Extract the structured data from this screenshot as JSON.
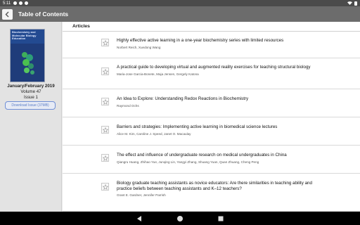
{
  "status": {
    "time": "5:11"
  },
  "toolbar": {
    "title": "Table of Contents"
  },
  "issue": {
    "cover_title": "Biochemistry and Molecular Biology Education",
    "date": "January/February 2019",
    "volume": "Volume 47",
    "number": "Issue 1",
    "download_label": "Download Issue (37MB)"
  },
  "main": {
    "header": "Articles",
    "articles": [
      {
        "title": "Highly effective active learning in a one-year biochemistry series with limited resources",
        "authors": "Norbert Reich, Xuedong Wang"
      },
      {
        "title": "A practical guide to developing virtual and augmented reality exercises for teaching structural biology",
        "authors": "Maria-Jose Garcia-Bonete, Maja Jensen, Gergely Katona"
      },
      {
        "title": "An Idea to Explore: Understanding Redox Reactions in Biochemistry",
        "authors": "Raymond Ochs"
      },
      {
        "title": "Barriers and strategies: Implementing active learning in biomedical science lectures",
        "authors": "Alice M. Kim, Caroline J. Speed, Janet O. Macaulay"
      },
      {
        "title": "The effect and influence of undergraduate research on medical undergraduates in China",
        "authors": "Qiangru Huang, Zhihao Yue, Junqing Lin, Yangyi Zhang, Shuang Yuan, Quan Zhuang, Cheng Peng"
      },
      {
        "title": "Biology graduate teaching assistants as novice educators: Are there similarities in teaching ability and practice beliefs between teaching assistants and K–12 teachers?",
        "authors": "Grant E. Gardner, Jennifer Parrish"
      }
    ]
  },
  "icons": {
    "back": "chevron-left-icon",
    "star": "star-outline-icon",
    "nav": [
      "back-triangle-icon",
      "home-circle-icon",
      "recents-square-icon"
    ]
  },
  "colors": {
    "toolbar": "#6c6c6c",
    "statusbar": "#4b4b4b",
    "sidebar": "#e3e3e3",
    "link": "#5b7ec7",
    "cover": "#1f3c7a"
  }
}
